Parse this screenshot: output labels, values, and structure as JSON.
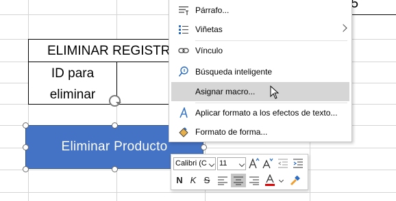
{
  "sheet": {
    "title_cell": "ELIMINAR REGISTR",
    "id_label": "ID para eliminar",
    "top_right_text": "5"
  },
  "shape": {
    "text": "Eliminar  Producto",
    "fill": "#4472c4"
  },
  "context_menu": {
    "items": [
      {
        "label": "Párrafo...",
        "icon": "paragraph-icon"
      },
      {
        "label": "Viñetas",
        "icon": "bullets-icon",
        "submenu": true
      },
      {
        "label": "Vínculo",
        "icon": "link-icon"
      },
      {
        "label": "Búsqueda inteligente",
        "icon": "smart-lookup-icon"
      },
      {
        "label": "Asignar macro...",
        "icon": "",
        "highlighted": true
      },
      {
        "label": "Aplicar formato a los efectos de texto...",
        "icon": "text-effects-icon"
      },
      {
        "label": "Formato de forma...",
        "icon": "format-shape-icon"
      }
    ]
  },
  "mini_toolbar": {
    "font_name": "Calibri (C",
    "font_size": "11",
    "bold": "N",
    "italic": "K",
    "strike": "S",
    "font_color": "#e00000",
    "highlight_color": "#f0a030"
  }
}
